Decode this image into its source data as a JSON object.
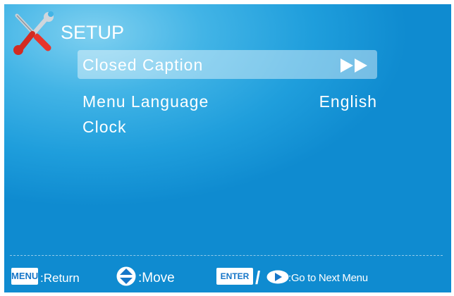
{
  "menu": {
    "title": "SETUP",
    "items": [
      {
        "label": "Closed Caption",
        "value": "",
        "selected": true
      },
      {
        "label": "Menu Language",
        "value": "English"
      },
      {
        "label": "Clock",
        "value": ""
      }
    ]
  },
  "footer": {
    "menu_key": "MENU",
    "menu_action": ":Return",
    "move_action": ":Move",
    "enter_key": "ENTER",
    "slash": "/",
    "enter_action": ":Go to Next Menu"
  },
  "icons": [
    "tools-icon",
    "fast-forward-icon",
    "up-down-arrows-icon",
    "right-arrow-icon"
  ],
  "colors": {
    "background": "#1f9edc",
    "highlight": "#a3d8ef",
    "text": "#ffffff",
    "key_text": "#1676c8"
  }
}
